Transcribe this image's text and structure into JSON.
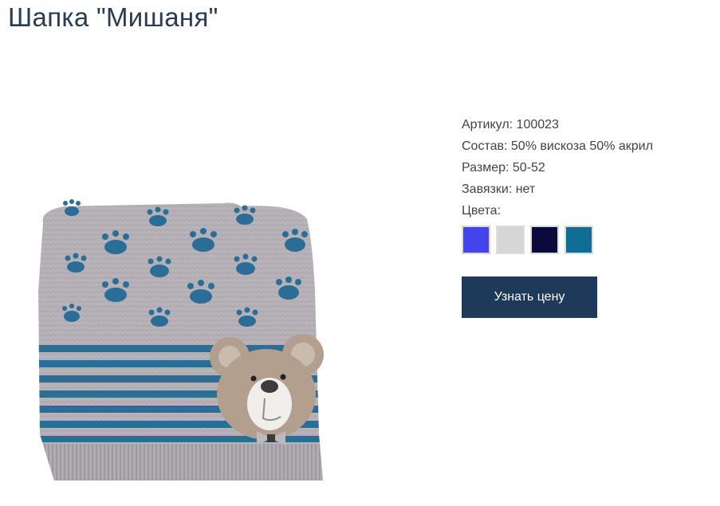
{
  "product": {
    "title": "Шапка \"Мишаня\"",
    "image_alt": "Шапка \"Мишаня\""
  },
  "specs": [
    {
      "label": "Артикул:",
      "value": "100023"
    },
    {
      "label": "Состав:",
      "value": "50% вискоза 50% акрил"
    },
    {
      "label": "Размер:",
      "value": "50-52"
    },
    {
      "label": "Завязки:",
      "value": "нет"
    }
  ],
  "colors_label": "Цвета:",
  "colors": [
    {
      "name": "blue",
      "hex": "#4444ee"
    },
    {
      "name": "light-gray",
      "hex": "#d6d6d6"
    },
    {
      "name": "navy",
      "hex": "#0a0a3c"
    },
    {
      "name": "teal",
      "hex": "#0e6e96"
    }
  ],
  "actions": {
    "price_button_label": "Узнать цену"
  }
}
